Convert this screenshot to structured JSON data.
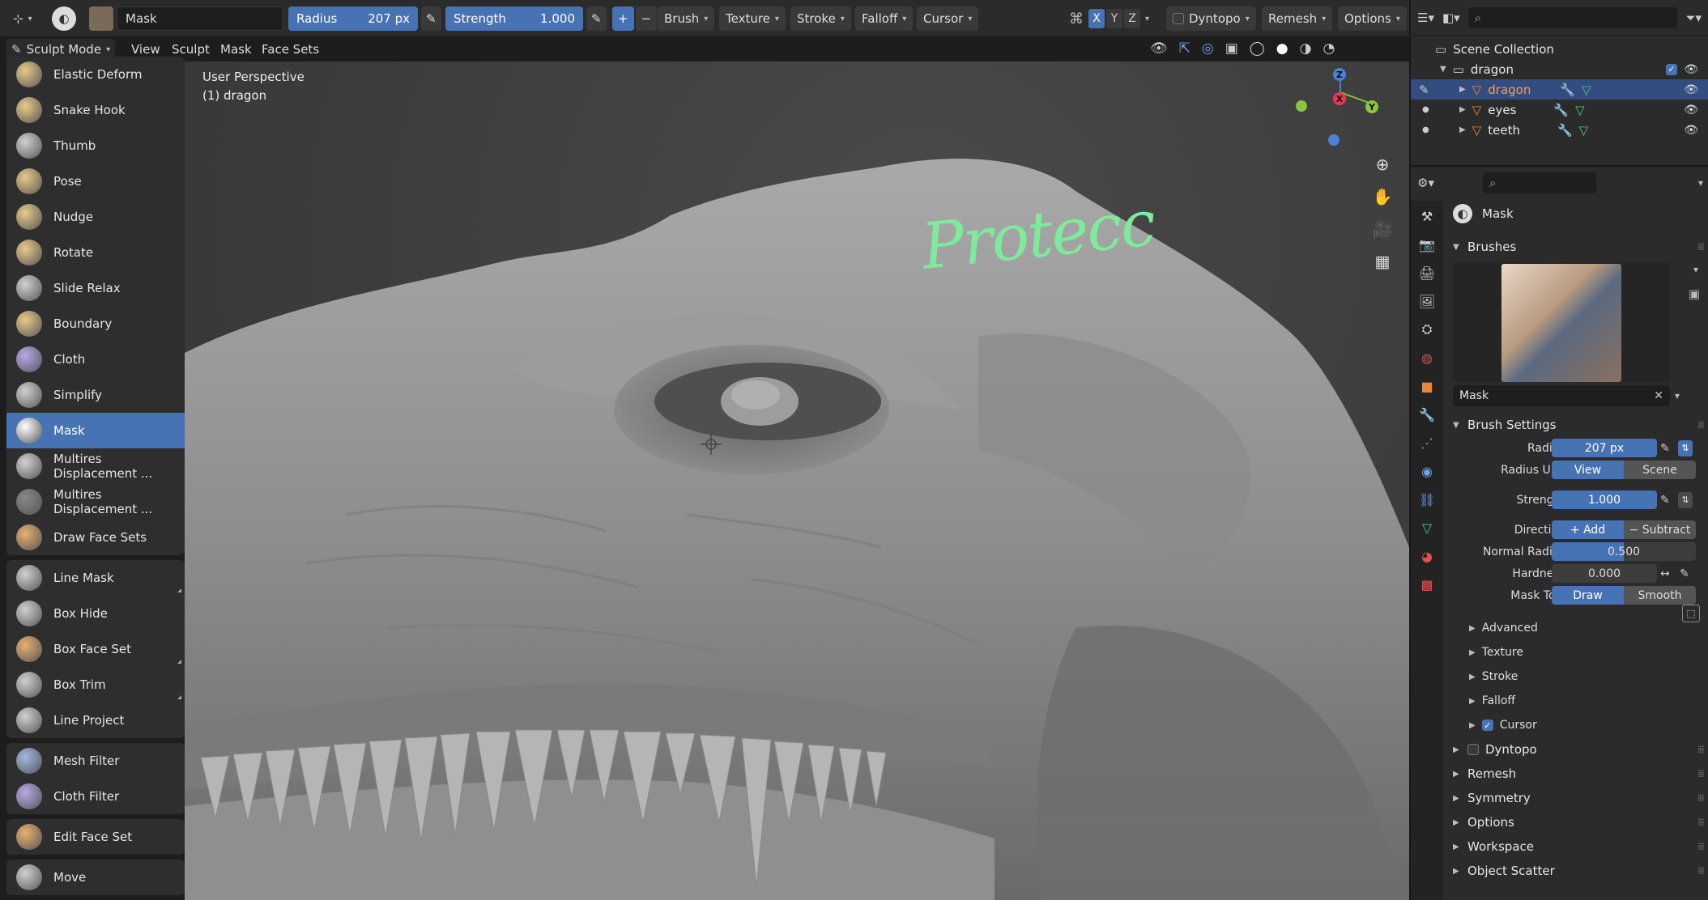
{
  "header": {
    "brush_name": "Mask",
    "radius_label": "Radius",
    "radius_value": "207 px",
    "strength_label": "Strength",
    "strength_value": "1.000",
    "menus": [
      "Brush",
      "Texture",
      "Stroke",
      "Falloff",
      "Cursor"
    ],
    "axes": [
      "X",
      "Y",
      "Z"
    ],
    "dyntopo": "Dyntopo",
    "remesh": "Remesh",
    "options": "Options"
  },
  "menubar": {
    "mode": "Sculpt Mode",
    "items": [
      "View",
      "Sculpt",
      "Mask",
      "Face Sets"
    ]
  },
  "tools": [
    {
      "group": [
        {
          "label": "Elastic Deform",
          "color": "#e8c98a"
        },
        {
          "label": "Snake Hook",
          "color": "#e8c98a"
        },
        {
          "label": "Thumb",
          "color": "#d0d0d0"
        },
        {
          "label": "Pose",
          "color": "#e8c98a"
        },
        {
          "label": "Nudge",
          "color": "#e8c98a"
        },
        {
          "label": "Rotate",
          "color": "#e8c98a"
        },
        {
          "label": "Slide Relax",
          "color": "#d0d0d0"
        },
        {
          "label": "Boundary",
          "color": "#e8c98a"
        },
        {
          "label": "Cloth",
          "color": "#b8a8e8"
        },
        {
          "label": "Simplify",
          "color": "#d0d0d0"
        },
        {
          "label": "Mask",
          "color": "#ffffff",
          "active": true
        },
        {
          "label": "Multires Displacement ...",
          "color": "#d0d0d0"
        },
        {
          "label": "Multires Displacement ...",
          "color": "#888888"
        },
        {
          "label": "Draw Face Sets",
          "color": "#e8b070"
        }
      ]
    },
    {
      "group": [
        {
          "label": "Line Mask",
          "color": "#d0d0d0",
          "corner": true
        },
        {
          "label": "Box Hide",
          "color": "#d0d0d0"
        },
        {
          "label": "Box Face Set",
          "color": "#e8b070",
          "corner": true
        },
        {
          "label": "Box Trim",
          "color": "#d0d0d0",
          "corner": true
        },
        {
          "label": "Line Project",
          "color": "#d0d0d0"
        }
      ]
    },
    {
      "group": [
        {
          "label": "Mesh Filter",
          "color": "#a0b8e0"
        },
        {
          "label": "Cloth Filter",
          "color": "#b8a8e8"
        }
      ]
    },
    {
      "group": [
        {
          "label": "Edit Face Set",
          "color": "#e8b070"
        }
      ]
    },
    {
      "group": [
        {
          "label": "Move",
          "color": "#d0d0d0"
        }
      ]
    }
  ],
  "viewport": {
    "perspective": "User Perspective",
    "object": "(1) dragon",
    "annotation": "Protecc",
    "annotation_color": "#7dea9c"
  },
  "outliner": {
    "collection": "Scene Collection",
    "root": "dragon",
    "children": [
      "dragon",
      "eyes",
      "teeth"
    ]
  },
  "properties": {
    "brush_title": "Mask",
    "brushes_section": "Brushes",
    "brush_field": "Mask",
    "brush_settings": "Brush Settings",
    "radius": {
      "label": "Radius",
      "value": "207 px"
    },
    "radius_unit": {
      "label": "Radius Unit",
      "opt1": "View",
      "opt2": "Scene"
    },
    "strength": {
      "label": "Strength",
      "value": "1.000"
    },
    "direction": {
      "label": "Direction",
      "opt1": "Add",
      "opt2": "Subtract"
    },
    "normal_radius": {
      "label": "Normal Radius",
      "value": "0.500",
      "fill": 0.5
    },
    "hardness": {
      "label": "Hardness",
      "value": "0.000"
    },
    "mask_tool": {
      "label": "Mask Tool",
      "opt1": "Draw",
      "opt2": "Smooth"
    },
    "subpanels": [
      "Advanced",
      "Texture",
      "Stroke",
      "Falloff",
      "Cursor"
    ],
    "sections": [
      "Dyntopo",
      "Remesh",
      "Symmetry",
      "Options",
      "Workspace",
      "Object Scatter"
    ]
  },
  "colors": {
    "accent": "#4772b3",
    "selected_row": "#334d80",
    "object_orange": "#e8883a",
    "mesh_green": "#4cc97a"
  }
}
